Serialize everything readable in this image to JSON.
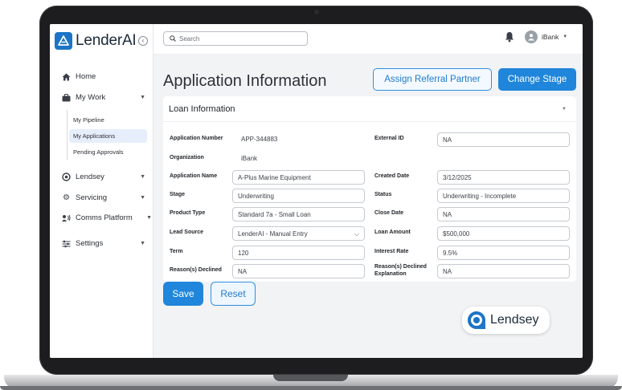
{
  "brand": {
    "name": "LenderAI"
  },
  "sidebar": {
    "items": [
      {
        "label": "Home"
      },
      {
        "label": "My Work"
      },
      {
        "label": "Lendsey"
      },
      {
        "label": "Servicing"
      },
      {
        "label": "Comms Platform"
      },
      {
        "label": "Settings"
      }
    ],
    "subitems": [
      {
        "label": "My Pipeline"
      },
      {
        "label": "My Applications"
      },
      {
        "label": "Pending Approvals"
      }
    ]
  },
  "topbar": {
    "search_placeholder": "Search",
    "user_name": "iBank"
  },
  "page": {
    "title": "Application Information",
    "assign_button": "Assign Referral Partner",
    "stage_button": "Change Stage"
  },
  "loan": {
    "section_title": "Loan Information",
    "application_number_label": "Application Number",
    "application_number": "APP-344883",
    "external_id_label": "External ID",
    "external_id": "NA",
    "organization_label": "Organization",
    "organization": "iBank",
    "application_name_label": "Application Name",
    "application_name": "A-Plus Marine Equipment",
    "created_date_label": "Created Date",
    "created_date": "3/12/2025",
    "stage_label": "Stage",
    "stage": "Underwriting",
    "status_label": "Status",
    "status": "Underwriting - Incomplete",
    "product_type_label": "Product Type",
    "product_type": "Standard 7a - Small Loan",
    "close_date_label": "Close Date",
    "close_date": "NA",
    "lead_source_label": "Lead Source",
    "lead_source": "LenderAI - Manual Entry",
    "loan_amount_label": "Loan Amount",
    "loan_amount": "$500,000",
    "term_label": "Term",
    "term": "120",
    "interest_rate_label": "Interest Rate",
    "interest_rate": "9.5%",
    "reasons_declined_label": "Reason(s) Declined",
    "reasons_declined": "NA",
    "reasons_declined_explanation_label_1": "Reason(s) Declined",
    "reasons_declined_explanation_label_2": "Explanation",
    "reasons_declined_explanation": "NA"
  },
  "actions": {
    "save": "Save",
    "reset": "Reset"
  },
  "badge": {
    "name": "Lendsey"
  },
  "colors": {
    "accent": "#1f86db",
    "brand": "#1c74c6"
  }
}
